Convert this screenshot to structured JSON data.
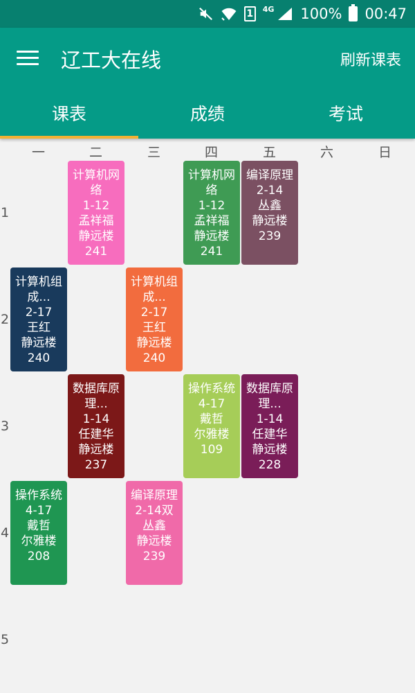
{
  "status_bar": {
    "sim_label": "1",
    "network_label": "4G",
    "battery": "100%",
    "time": "00:47"
  },
  "app_bar": {
    "title": "辽工大在线",
    "refresh_label": "刷新课表"
  },
  "tabs": [
    {
      "label": "课表"
    },
    {
      "label": "成绩"
    },
    {
      "label": "考试"
    }
  ],
  "days": [
    "一",
    "二",
    "三",
    "四",
    "五",
    "六",
    "日"
  ],
  "periods": [
    "1",
    "2",
    "3",
    "4",
    "5"
  ],
  "courses": [
    {
      "day": 2,
      "period": 1,
      "lines": [
        "计算机网",
        "络",
        "1-12",
        "孟祥福",
        "静远楼",
        "241"
      ],
      "color": "#f76dbe"
    },
    {
      "day": 4,
      "period": 1,
      "lines": [
        "计算机网",
        "络",
        "1-12",
        "孟祥福",
        "静远楼",
        "241"
      ],
      "color": "#3f9b54"
    },
    {
      "day": 5,
      "period": 1,
      "lines": [
        "编译原理",
        "2-14",
        "丛鑫",
        "静远楼",
        "239"
      ],
      "color": "#7b5062"
    },
    {
      "day": 1,
      "period": 2,
      "lines": [
        "计算机组",
        "成...",
        "2-17",
        "王红",
        "静远楼",
        "240"
      ],
      "color": "#193a5c"
    },
    {
      "day": 3,
      "period": 2,
      "lines": [
        "计算机组",
        "成...",
        "2-17",
        "王红",
        "静远楼",
        "240"
      ],
      "color": "#f26c3e"
    },
    {
      "day": 2,
      "period": 3,
      "lines": [
        "数据库原",
        "理...",
        "1-14",
        "任建华",
        "静远楼",
        "237"
      ],
      "color": "#7c1818"
    },
    {
      "day": 4,
      "period": 3,
      "lines": [
        "操作系统",
        "4-17",
        "戴哲",
        "尔雅楼",
        "109"
      ],
      "color": "#a6cd58"
    },
    {
      "day": 5,
      "period": 3,
      "lines": [
        "数据库原",
        "理...",
        "1-14",
        "任建华",
        "静远楼",
        "228"
      ],
      "color": "#7a1d58"
    },
    {
      "day": 1,
      "period": 4,
      "lines": [
        "操作系统",
        "4-17",
        "戴哲",
        "尔雅楼",
        "208"
      ],
      "color": "#1f9652"
    },
    {
      "day": 3,
      "period": 4,
      "lines": [
        "编译原理",
        "2-14双",
        "丛鑫",
        "静远楼",
        "239"
      ],
      "color": "#f06aa9"
    }
  ]
}
